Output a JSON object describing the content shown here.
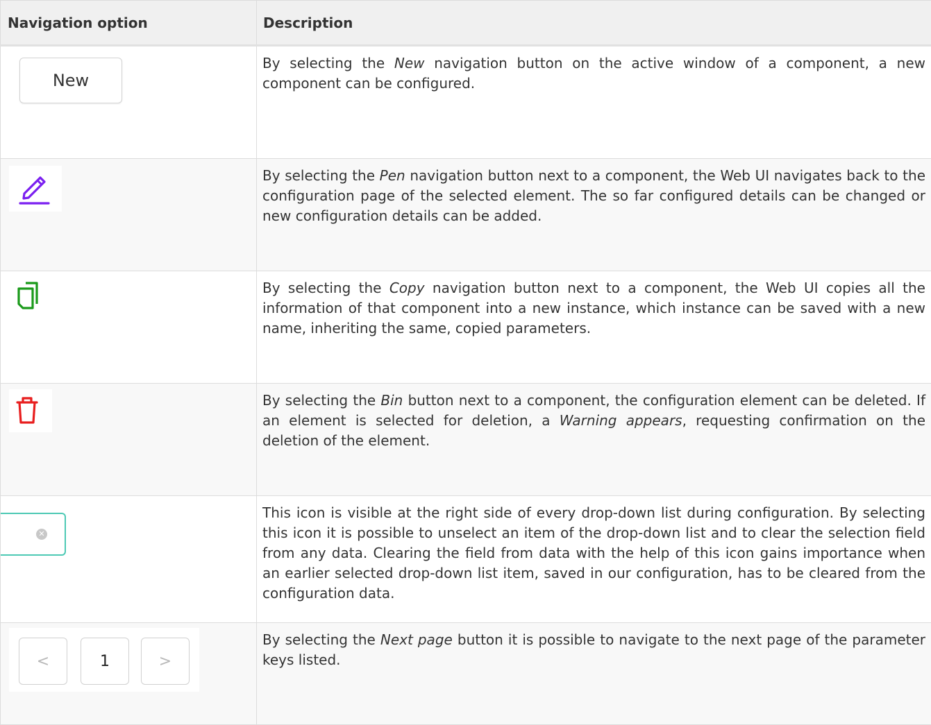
{
  "headers": {
    "option": "Navigation option",
    "description": "Description"
  },
  "rows": [
    {
      "button_label": "New",
      "icon": "new-button",
      "desc": [
        "By selecting the ",
        "New",
        " navigation button on the active window of a component, a new component can be configured."
      ]
    },
    {
      "icon": "pen-icon",
      "icon_color": "#7a1ff0",
      "desc": [
        "By selecting the ",
        "Pen",
        " navigation button next to a component, the Web UI navigates back to the configuration page of the selected element. The so far configured details can be changed or new configuration details can be added."
      ]
    },
    {
      "icon": "copy-icon",
      "icon_color": "#1a9a1a",
      "desc": [
        "By selecting the ",
        "Copy",
        " navigation button next to a component, the Web UI copies all the information of that component into a new instance, which instance can be saved with a new name, inheriting the same, copied parameters."
      ]
    },
    {
      "icon": "bin-icon",
      "icon_color": "#e81e1e",
      "desc": [
        "By selecting the ",
        "Bin",
        " button next to a component, the configuration element can be deleted. If an element is selected for deletion, a ",
        "Warning appears",
        ", requesting confirmation on the deletion of the element."
      ]
    },
    {
      "icon": "clear-selection-icon",
      "icon_color": "#4cc9b4",
      "desc": [
        "This icon is visible at the right side of every drop-down list during configuration. By selecting this icon it is possible to unselect an item of the drop-down list and to clear the selection field from any data. Clearing the field from data with the help of this icon gains importance when an earlier selected drop-down list item, saved in our configuration, has to be cleared from the configuration data."
      ]
    },
    {
      "icon": "pagination",
      "pager": {
        "prev": "<",
        "page": "1",
        "next": ">"
      },
      "desc": [
        "By selecting the ",
        "Next page",
        " button it is possible to navigate to the next page of the parameter keys listed."
      ]
    }
  ]
}
